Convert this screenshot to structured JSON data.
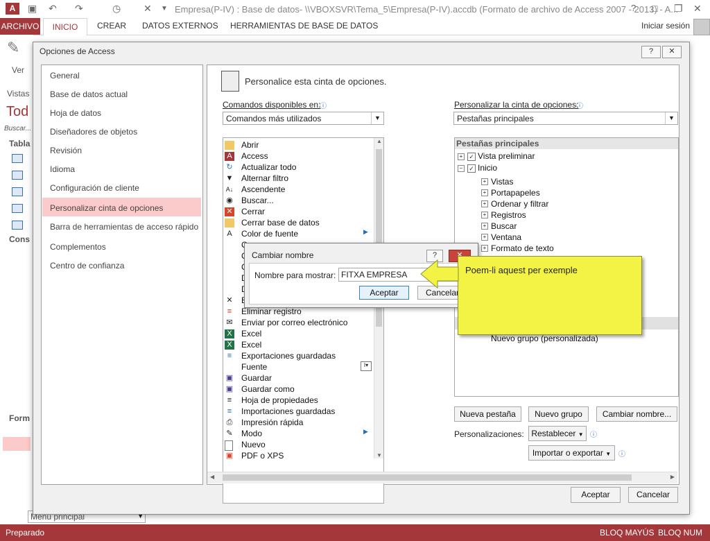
{
  "titlebar": {
    "title": "Empresa(P-IV) : Base de datos- \\\\VBOXSVR\\Tema_5\\Empresa(P-IV).accdb (Formato de archivo de Access 2007 - 2013) - A...",
    "app_icon": "access-icon"
  },
  "ribbon_tabs": {
    "archivo": "ARCHIVO",
    "inicio": "INICIO",
    "crear": "CREAR",
    "datos_externos": "DATOS EXTERNOS",
    "herramientas": "HERRAMIENTAS DE BASE DE DATOS",
    "signin": "Iniciar sesión"
  },
  "background": {
    "ver": "Ver",
    "vistas": "Vistas",
    "todos": "Tod",
    "buscar": "Buscar...",
    "tablas": "Tabla",
    "consultas": "Cons",
    "formularios": "Form",
    "menu_principal": "Menú principal"
  },
  "options": {
    "title": "Opciones de Access",
    "help": "?",
    "close": "✕",
    "categories": [
      "General",
      "Base de datos actual",
      "Hoja de datos",
      "Diseñadores de objetos",
      "Revisión",
      "Idioma",
      "Configuración de cliente",
      "Personalizar cinta de opciones",
      "Barra de herramientas de acceso rápido",
      "Complementos",
      "Centro de confianza"
    ],
    "header": "Personalice esta cinta de opciones.",
    "commands_label": "Comandos disponibles en:",
    "commands_value": "Comandos más utilizados",
    "ribbon_label": "Personalizar la cinta de opciones:",
    "ribbon_value": "Pestañas principales",
    "command_list": [
      "Abrir",
      "Access",
      "Actualizar todo",
      "Alternar filtro",
      "Ascendente",
      "Buscar...",
      "Cerrar",
      "Cerrar base de datos",
      "Color de fuente",
      "C",
      "C",
      "C",
      "D",
      "D",
      "E",
      "Eliminar registro",
      "Enviar por correo electrónico",
      "Excel",
      "Excel",
      "Exportaciones guardadas",
      "Fuente",
      "Guardar",
      "Guardar como",
      "Hoja de propiedades",
      "Importaciones guardadas",
      "Impresión rápida",
      "Modo",
      "Nuevo",
      "PDF o XPS"
    ],
    "tree_header": "Pestañas principales",
    "tree": {
      "vista_preliminar": "Vista preliminar",
      "inicio": "Inicio",
      "groups": [
        "Vistas",
        "Portapapeles",
        "Ordenar y filtrar",
        "Registros",
        "Buscar",
        "Ventana",
        "Formato de texto"
      ],
      "new_group": "Nuevo grupo (personalizada)"
    },
    "buttons": {
      "nueva_pestana": "Nueva pestaña",
      "nuevo_grupo": "Nuevo grupo",
      "cambiar_nombre": "Cambiar nombre...",
      "personalizaciones": "Personalizaciones:",
      "restablecer": "Restablecer",
      "importar_exportar": "Importar o exportar",
      "aceptar": "Aceptar",
      "cancelar": "Cancelar"
    }
  },
  "rename_dialog": {
    "title": "Cambiar nombre",
    "help": "?",
    "close": "✕",
    "label": "Nombre para mostrar:",
    "value": "FITXA EMPRESA",
    "ok": "Aceptar",
    "cancel": "Cancelar"
  },
  "callout": {
    "text": "Poem-li aquest per exemple"
  },
  "statusbar": {
    "left": "Preparado",
    "caps": "BLOQ MAYÚS",
    "num": "BLOQ NUM"
  },
  "colors": {
    "accent": "#a4373a",
    "selection": "#fbcaca",
    "callout": "#f3f345"
  }
}
